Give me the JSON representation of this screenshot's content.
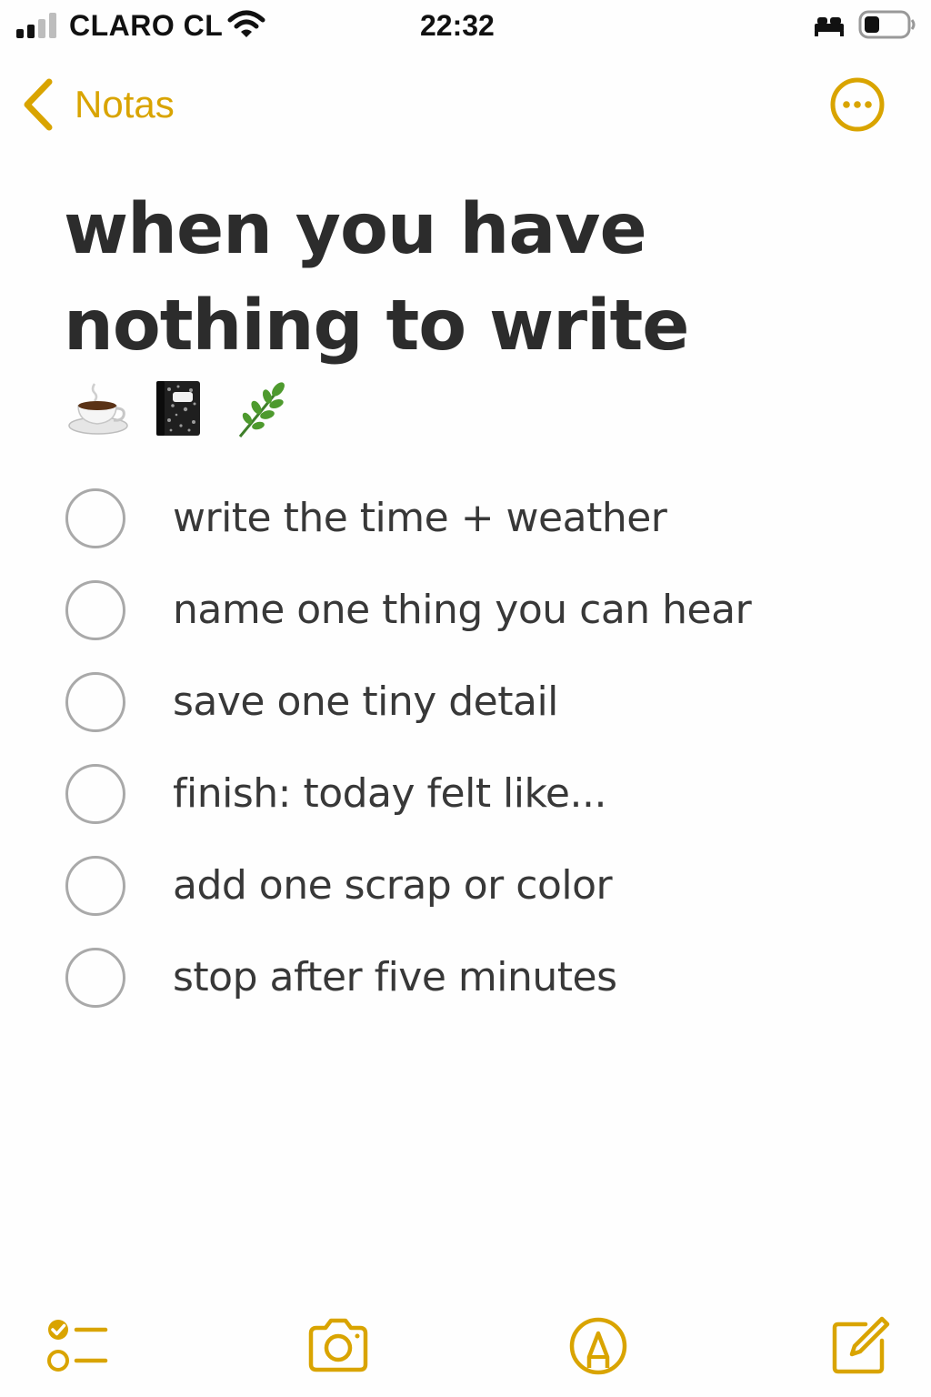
{
  "status_bar": {
    "carrier": "CLARO CL",
    "time": "22:32",
    "icons": [
      "signal-icon",
      "wifi-icon",
      "sleep-focus-icon",
      "battery-icon"
    ]
  },
  "nav": {
    "back_label": "Notas",
    "back_icon": "chevron-left-icon",
    "more_icon": "ellipsis-circle-icon"
  },
  "note": {
    "title_line1": "when you have",
    "title_line2": "nothing to write",
    "emoji_icons": [
      "coffee-cup-icon",
      "composition-notebook-icon",
      "herb-icon"
    ],
    "checklist": [
      {
        "text": "write the time + weather",
        "checked": false
      },
      {
        "text": "name one thing you can hear",
        "checked": false
      },
      {
        "text": "save one tiny detail",
        "checked": false
      },
      {
        "text": "finish: today felt like...",
        "checked": false
      },
      {
        "text": "add one scrap or color",
        "checked": false
      },
      {
        "text": "stop after five minutes",
        "checked": false
      }
    ]
  },
  "toolbar": {
    "icons": [
      "checklist-icon",
      "camera-icon",
      "markup-pen-icon",
      "compose-icon"
    ]
  },
  "colors": {
    "accent": "#d9a400",
    "title": "#2c2c2c",
    "text": "#383838",
    "circle": "#a9a9a9",
    "background": "#fefefe"
  }
}
